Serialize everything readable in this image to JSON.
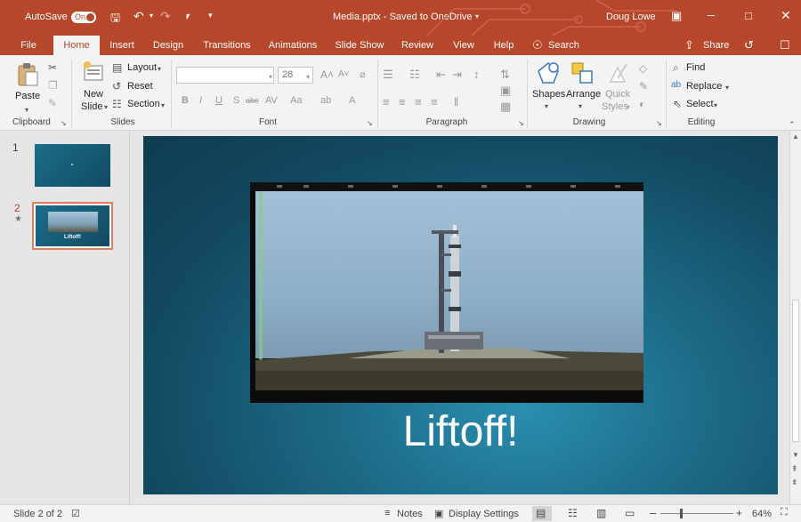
{
  "titlebar": {
    "autosave_label": "AutoSave",
    "autosave_state": "On",
    "doc_title": "Media.pptx - Saved to OneDrive",
    "user_name": "Doug Lowe"
  },
  "tabs": [
    "File",
    "Home",
    "Insert",
    "Design",
    "Transitions",
    "Animations",
    "Slide Show",
    "Review",
    "View",
    "Help"
  ],
  "search_label": "Search",
  "share_label": "Share",
  "ribbon": {
    "clipboard": {
      "paste": "Paste",
      "group": "Clipboard"
    },
    "slides": {
      "new_slide_1": "New",
      "new_slide_2": "Slide",
      "layout": "Layout",
      "reset": "Reset",
      "section": "Section",
      "group": "Slides"
    },
    "font": {
      "size": "28",
      "group": "Font"
    },
    "paragraph": {
      "group": "Paragraph"
    },
    "drawing": {
      "shapes": "Shapes",
      "arrange": "Arrange",
      "quick": "Quick",
      "styles": "Styles",
      "group": "Drawing"
    },
    "editing": {
      "find": "Find",
      "replace": "Replace",
      "select": "Select",
      "group": "Editing"
    }
  },
  "thumbnails": [
    {
      "number": "1",
      "text": ""
    },
    {
      "number": "2",
      "text": "Liftoff!"
    }
  ],
  "slide": {
    "title": "Liftoff!"
  },
  "status": {
    "slide_info": "Slide 2 of 2",
    "notes": "Notes",
    "display": "Display Settings",
    "zoom": "64%"
  }
}
